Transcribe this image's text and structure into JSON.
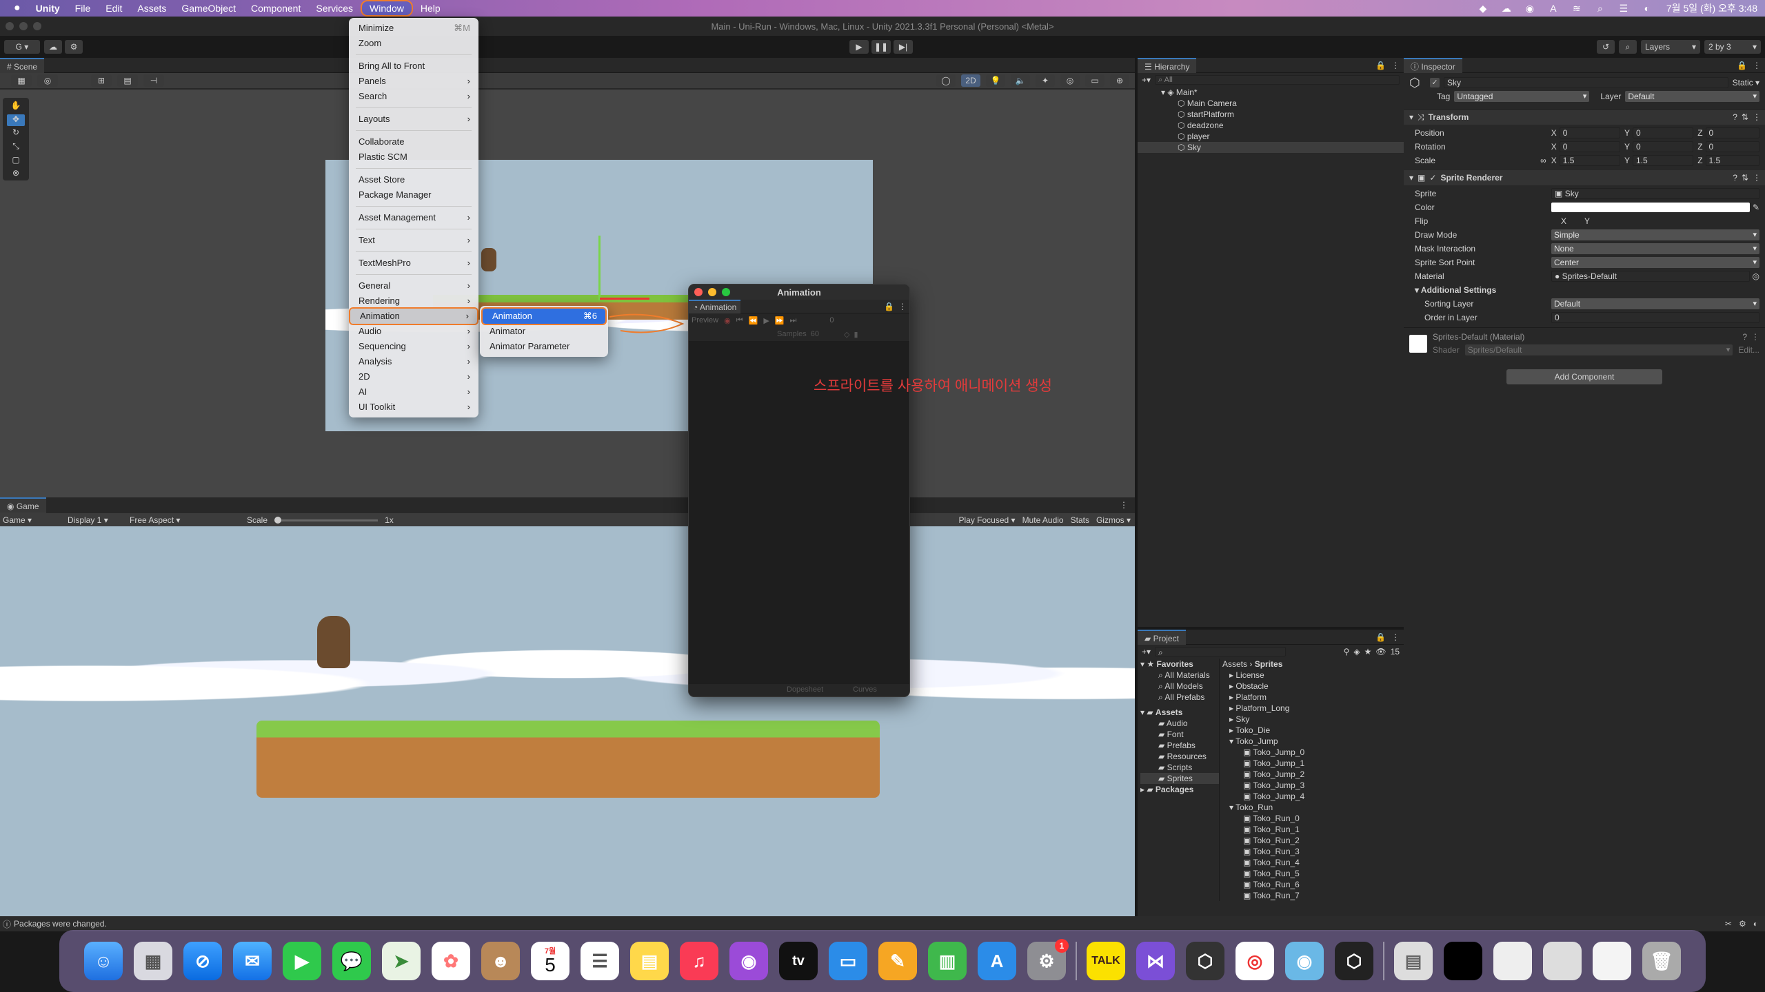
{
  "menubar": {
    "apple": "",
    "items": [
      "Unity",
      "File",
      "Edit",
      "Assets",
      "GameObject",
      "Component",
      "Services",
      "Window",
      "Help"
    ],
    "datetime": "7월 5일 (화) 오후 3:48"
  },
  "titlebar": {
    "title": "Main - Uni-Run - Windows, Mac, Linux - Unity 2021.3.3f1 Personal (Personal) <Metal>"
  },
  "toolbar": {
    "account": "G ▾",
    "layers": "Layers",
    "layout": "2 by 3"
  },
  "scene": {
    "tab": "Scene",
    "mode2d": "2D"
  },
  "game": {
    "tab": "Game",
    "mode": "Game",
    "display": "Display 1",
    "aspect": "Free Aspect",
    "scale_label": "Scale",
    "scale_value": "1x",
    "play_focused": "Play Focused",
    "mute": "Mute Audio",
    "stats": "Stats",
    "gizmos": "Gizmos"
  },
  "hierarchy": {
    "tab": "Hierarchy",
    "search": "All",
    "scene": "Main*",
    "items": [
      "Main Camera",
      "startPlatform",
      "deadzone",
      "player",
      "Sky"
    ]
  },
  "project": {
    "tab": "Project",
    "favorites": "Favorites",
    "fav_items": [
      "All Materials",
      "All Models",
      "All Prefabs"
    ],
    "assets": "Assets",
    "asset_folders": [
      "Audio",
      "Font",
      "Prefabs",
      "Resources",
      "Scripts",
      "Sprites"
    ],
    "packages": "Packages",
    "breadcrumb": [
      "Assets",
      "Sprites"
    ],
    "files": [
      "License",
      "Obstacle",
      "Platform",
      "Platform_Long",
      "Sky",
      "Toko_Die",
      "Toko_Jump",
      "Toko_Jump_0",
      "Toko_Jump_1",
      "Toko_Jump_2",
      "Toko_Jump_3",
      "Toko_Jump_4",
      "Toko_Run",
      "Toko_Run_0",
      "Toko_Run_1",
      "Toko_Run_2",
      "Toko_Run_3",
      "Toko_Run_4",
      "Toko_Run_5",
      "Toko_Run_6",
      "Toko_Run_7"
    ],
    "count": "15"
  },
  "inspector": {
    "tab": "Inspector",
    "name": "Sky",
    "static": "Static",
    "tag_label": "Tag",
    "tag": "Untagged",
    "layer_label": "Layer",
    "layer": "Default",
    "transform": {
      "title": "Transform",
      "position": "Position",
      "rotation": "Rotation",
      "scale": "Scale",
      "px": "0",
      "py": "0",
      "pz": "0",
      "rx": "0",
      "ry": "0",
      "rz": "0",
      "sx": "1.5",
      "sy": "1.5",
      "sz": "1.5",
      "x": "X",
      "y": "Y",
      "z": "Z"
    },
    "sprite_renderer": {
      "title": "Sprite Renderer",
      "sprite_label": "Sprite",
      "sprite": "Sky",
      "color_label": "Color",
      "flip_label": "Flip",
      "flip_x": "X",
      "flip_y": "Y",
      "draw_mode_label": "Draw Mode",
      "draw_mode": "Simple",
      "mask_label": "Mask Interaction",
      "mask": "None",
      "sort_point_label": "Sprite Sort Point",
      "sort_point": "Center",
      "material_label": "Material",
      "material": "Sprites-Default",
      "additional": "Additional Settings",
      "sorting_layer_label": "Sorting Layer",
      "sorting_layer": "Default",
      "order_label": "Order in Layer",
      "order": "0"
    },
    "material": {
      "name": "Sprites-Default (Material)",
      "shader_label": "Shader",
      "shader": "Sprites/Default",
      "edit": "Edit..."
    },
    "add_component": "Add Component"
  },
  "window_menu": {
    "items": [
      "Minimize",
      "Zoom",
      "Bring All to Front",
      "Panels",
      "Search",
      "Layouts",
      "Collaborate",
      "Plastic SCM",
      "Asset Store",
      "Package Manager",
      "Asset Management",
      "Text",
      "TextMeshPro",
      "General",
      "Rendering",
      "Animation",
      "Audio",
      "Sequencing",
      "Analysis",
      "2D",
      "AI",
      "UI Toolkit"
    ],
    "minimize_shortcut": "⌘M"
  },
  "anim_submenu": {
    "items": [
      "Animation",
      "Animator",
      "Animator Parameter"
    ],
    "shortcut": "⌘6"
  },
  "anim_window": {
    "title": "Animation",
    "tab": "Animation",
    "preview": "Preview",
    "samples_label": "Samples",
    "samples": "60",
    "frame": "0",
    "dopesheet": "Dopesheet",
    "curves": "Curves"
  },
  "annotation": "스프라이트를 사용하여 애니메이션 생성",
  "status": {
    "text": "Packages were changed."
  },
  "dock": {
    "calendar_month": "7월",
    "calendar_day": "5",
    "badge": "1",
    "kakao": "TALK",
    "tv": "tv"
  },
  "colors": {
    "accent": "#3a79bb",
    "highlight": "#f07c2b",
    "annotation": "#e23b3b"
  }
}
